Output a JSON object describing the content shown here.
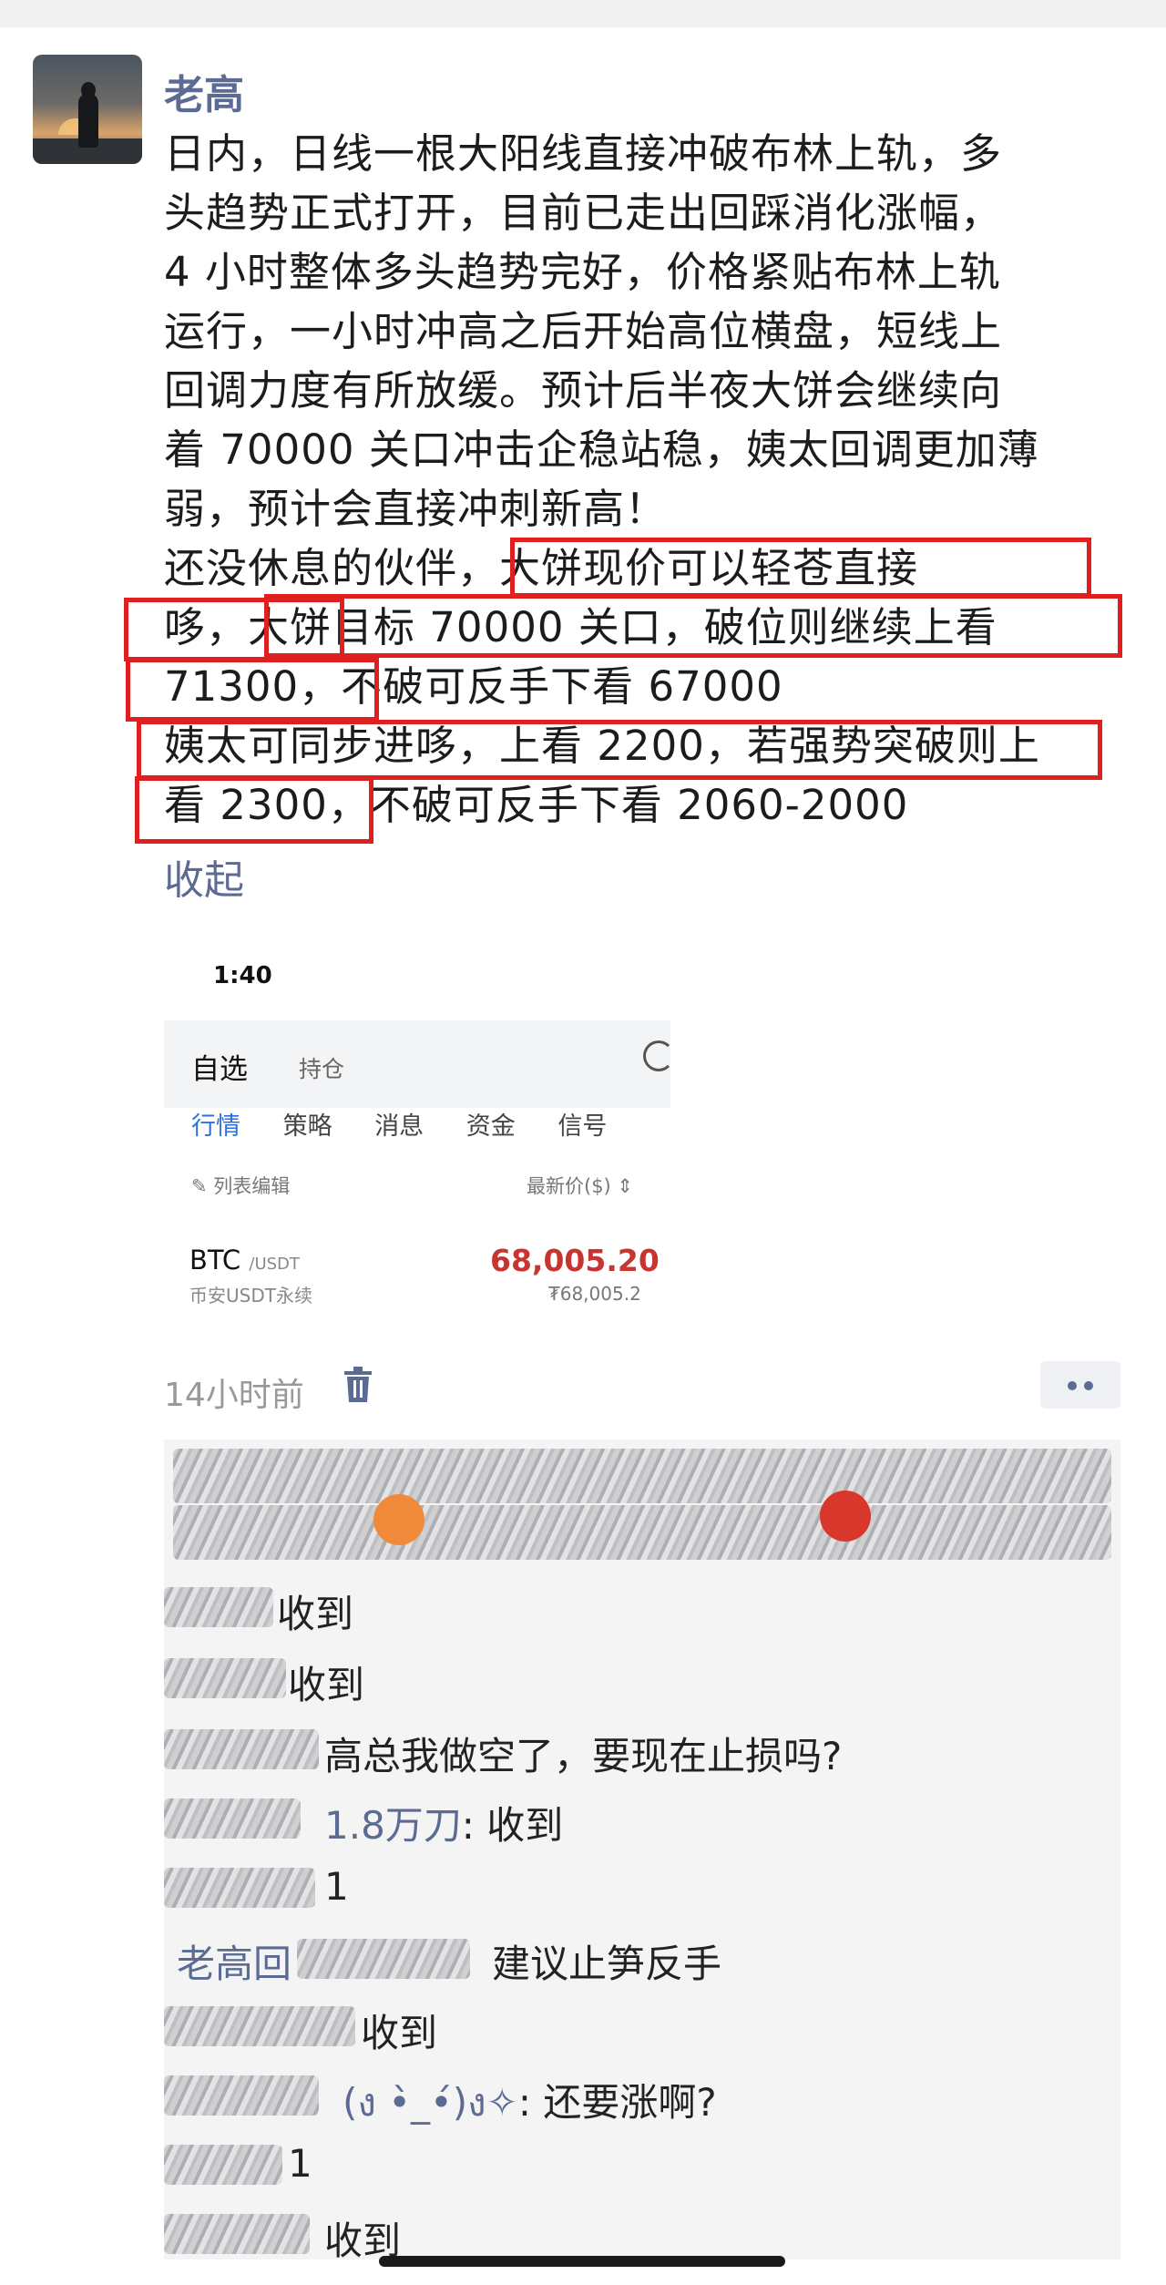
{
  "post": {
    "username": "老高",
    "lines": [
      "日内，日线一根大阳线直接冲破布林上轨，多",
      "头趋势正式打开，目前已走出回踩消化涨幅，",
      "4 小时整体多头趋势完好，价格紧贴布林上轨",
      "运行，一小时冲高之后开始高位横盘，短线上",
      "回调力度有所放缓。预计后半夜大饼会继续向",
      "着 70000 关口冲击企稳站稳，姨太回调更加薄",
      "弱，预计会直接冲刺新高！",
      "还没休息的伙伴，大饼现价可以轻苍直接",
      "哆，大饼目标 70000 关口，破位则继续上看",
      "71300，不破可反手下看 67000",
      "姨太可同步进哆，上看 2200，若强势突破则上",
      "看 2300，不破可反手下看 2060-2000"
    ],
    "collapse_label": "收起",
    "time_ago": "14小时前"
  },
  "screenshot": {
    "time": "1:40",
    "seg_selected": "自选",
    "seg_other": "持仓",
    "tabs": [
      "行情",
      "策略",
      "消息",
      "资金",
      "信号"
    ],
    "list_edit": "列表编辑",
    "price_header": "最新价($)",
    "symbol": "BTC",
    "quote": "/USDT",
    "symbol_sub": "币安USDT永续",
    "price": "68,005.20",
    "price_alt": "₮68,005.2"
  },
  "comments": [
    {
      "nick": "",
      "text": "收到"
    },
    {
      "nick": "",
      "text": "收到"
    },
    {
      "nick": "",
      "text": "高总我做空了，要现在止损吗?"
    },
    {
      "nick": "1.8万刀",
      "text": ": 收到"
    },
    {
      "nick": "",
      "text": "1"
    },
    {
      "nick": "老高回",
      "text": "建议止笋反手"
    },
    {
      "nick": "",
      "text": "收到"
    },
    {
      "nick": "(ง •̀_•́)ง✧",
      "text": ": 还要涨啊?"
    },
    {
      "nick": "",
      "text": "1"
    },
    {
      "nick": "",
      "text": "收到"
    }
  ],
  "colors": {
    "name_blue": "#5b6b93",
    "highlight_red": "#e02020",
    "price_red": "#c8342f",
    "tab_blue": "#2e6fd8"
  }
}
